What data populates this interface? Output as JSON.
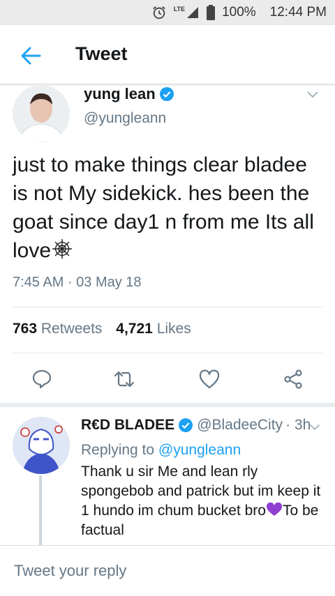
{
  "status_bar": {
    "network": "LTE",
    "battery": "100%",
    "time": "12:44 PM"
  },
  "header": {
    "title": "Tweet",
    "back_icon": "arrow-left-icon"
  },
  "tweet": {
    "author_name": "yung lean",
    "author_handle": "@yungleann",
    "text": "just to make things clear bladee is not My sidekick. hes been the goat since day1 n from me Its all love",
    "emoji": "spider-web",
    "time": "7:45 AM · 03 May 18",
    "retweets_count": "763",
    "retweets_label": "Retweets",
    "likes_count": "4,721",
    "likes_label": "Likes"
  },
  "reply": {
    "author_name": "R€D BLADEE",
    "author_handle": "@BladeeCity",
    "time": "· 3h",
    "replying_prefix": "Replying to",
    "replying_handle": "@yungleann",
    "text_before": "Thank u sir Me and lean rly spongebob and patrick but im keep it 1 hundo im chum bucket bro",
    "text_after": "To be factual"
  },
  "compose": {
    "placeholder": "Tweet your reply"
  },
  "colors": {
    "accent": "#1da1f2",
    "muted": "#657786",
    "heart": "#8e3fd1"
  }
}
